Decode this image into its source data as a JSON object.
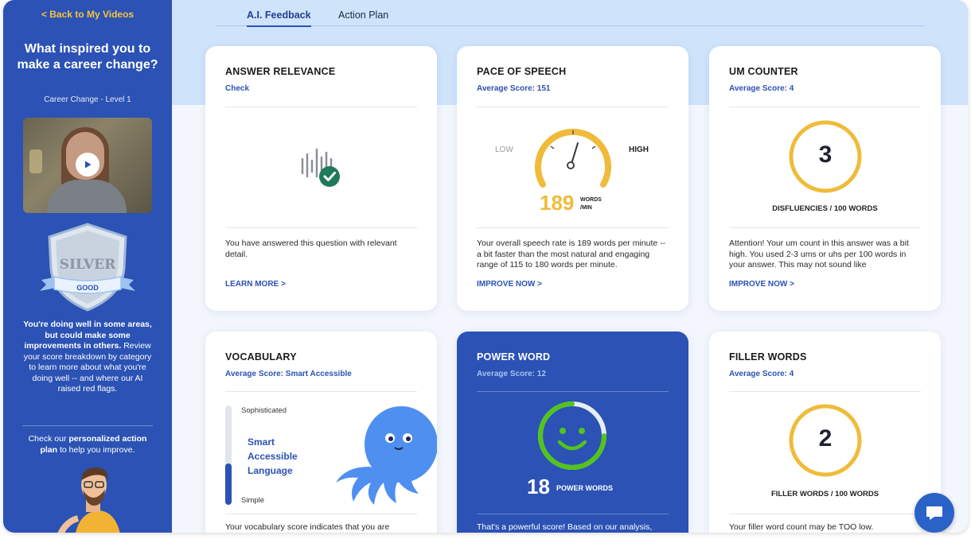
{
  "sidebar": {
    "back_label": "< Back to My Videos",
    "question": "What inspired you to make a career change?",
    "subtitle": "Career Change - Level 1",
    "badge_tier": "SILVER",
    "badge_rating": "GOOD",
    "summary_bold": "You're doing well in some areas, but could make some improvements in others.",
    "summary_rest": "Review your score breakdown by category to learn more about what you're doing well -- and where our AI raised red flags.",
    "action_prefix": "Check our",
    "action_bold": "personalized action plan",
    "action_suffix": "to help you improve."
  },
  "tabs": [
    {
      "label": "A.I. Feedback",
      "active": true
    },
    {
      "label": "Action Plan",
      "active": false
    }
  ],
  "cards": {
    "relevance": {
      "title": "ANSWER RELEVANCE",
      "score": "Check",
      "text": "You have answered this question with relevant detail.",
      "link": "LEARN MORE >"
    },
    "pace": {
      "title": "PACE OF SPEECH",
      "score": "Average Score: 151",
      "low_label": "LOW",
      "high_label": "HIGH",
      "value": "189",
      "unit_line1": "WORDS",
      "unit_line2": "/MIN",
      "text": "Your overall speech rate is 189 words per minute -- a bit faster than the most natural and engaging range of 115 to 180 words per minute.",
      "link": "IMPROVE NOW >"
    },
    "um": {
      "title": "UM COUNTER",
      "score": "Average Score: 4",
      "value": "3",
      "caption": "DISFLUENCIES / 100 WORDS",
      "text": "Attention! Your um count in this answer was a bit high. You used 2-3 ums or uhs per 100 words in your answer. This may not sound like",
      "link": "IMPROVE NOW >"
    },
    "vocab": {
      "title": "VOCABULARY",
      "score": "Average Score: Smart Accessible",
      "top_label": "Sophisticated",
      "bottom_label": "Simple",
      "level": "Smart Accessible Language",
      "level_fraction": 0.42,
      "text": "Your vocabulary score indicates that you are"
    },
    "power": {
      "title": "POWER WORD",
      "score": "Average Score: 12",
      "value": "18",
      "unit": "POWER WORDS",
      "text": "That's a powerful score! Based on our analysis,"
    },
    "filler": {
      "title": "FILLER WORDS",
      "score": "Average Score: 4",
      "value": "2",
      "caption": "FILLER WORDS / 100 WORDS",
      "text": "Your filler word count may be TOO low."
    }
  },
  "colors": {
    "brand_blue": "#2b52b4",
    "accent_yellow": "#f0bb3a",
    "success_green": "#4cbf3b",
    "hero_band": "#cfe3fb"
  },
  "icons": {
    "relevance": "waveform-check-icon",
    "chat": "chat-bubble-icon",
    "play": "play-icon"
  }
}
